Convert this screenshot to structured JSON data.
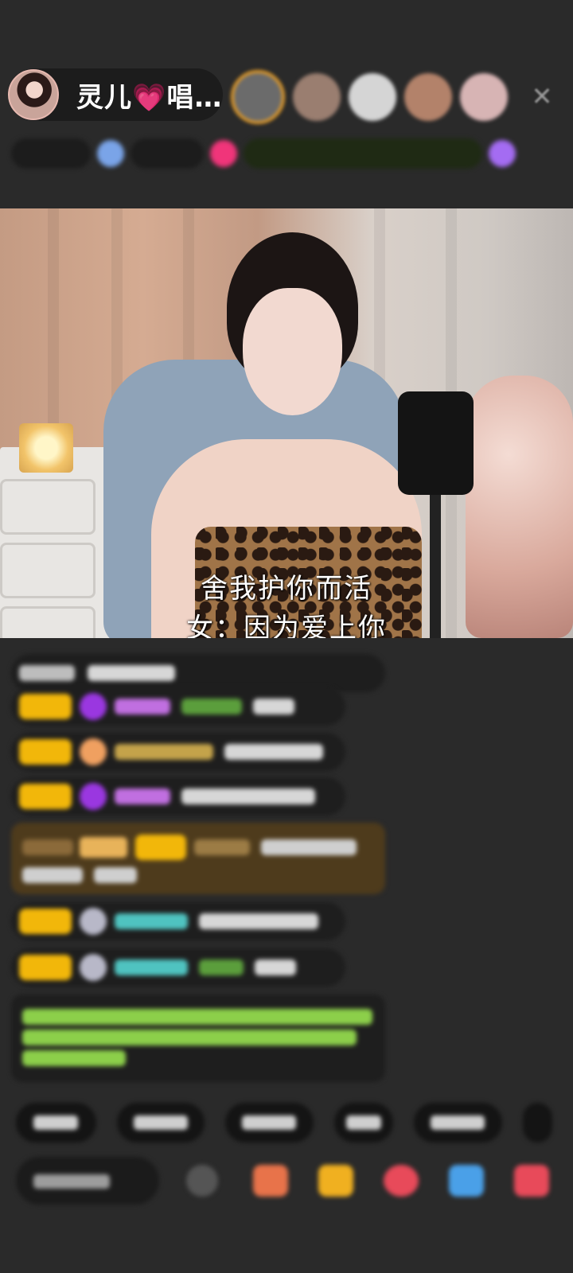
{
  "header": {
    "host_name": "灵儿💗唱…",
    "close_icon": "close-icon"
  },
  "viewers": [
    {
      "name": "viewer-top-1",
      "color": "#6b6b6b",
      "ring": true
    },
    {
      "name": "viewer-2",
      "color": "#9a7e70"
    },
    {
      "name": "viewer-3",
      "color": "#cfcfcf"
    },
    {
      "name": "viewer-4",
      "color": "#b3826a"
    },
    {
      "name": "viewer-5",
      "color": "#d7b4b4"
    }
  ],
  "video": {
    "lyrics_line1": "舍我护你而活",
    "lyrics_line2": "女：因为爱上你"
  },
  "colors": {
    "background": "#2a2a2a",
    "badge_gold": "#f2b70a",
    "gift_row": "#4e3b1c",
    "system_text": "#8ccf4a",
    "chat_name_purple": "#c06fe0",
    "chat_name_teal": "#4fc3c0"
  }
}
